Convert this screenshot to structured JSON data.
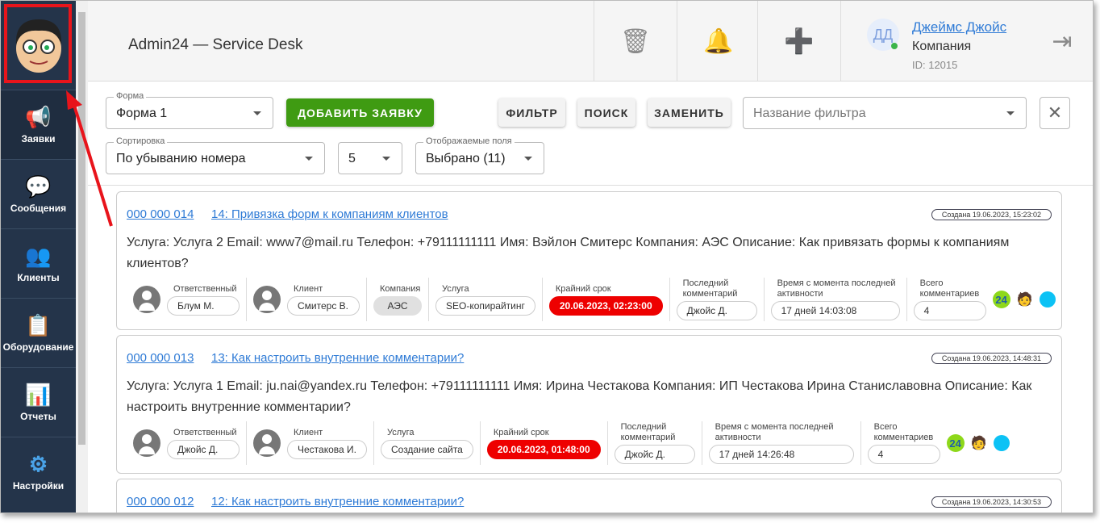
{
  "sidebar": {
    "items": [
      {
        "label": "Заявки",
        "icon": "megaphone-icon"
      },
      {
        "label": "Сообщения",
        "icon": "chat-icon"
      },
      {
        "label": "Клиенты",
        "icon": "clients-icon"
      },
      {
        "label": "Оборудование",
        "icon": "equipment-icon"
      },
      {
        "label": "Отчеты",
        "icon": "reports-icon"
      },
      {
        "label": "Настройки",
        "icon": "gear-icon"
      }
    ]
  },
  "header": {
    "title": "Admin24 — Service Desk",
    "user": {
      "initials": "ДД",
      "name": "Джеймс Джойс",
      "company": "Компания",
      "id": "ID: 12015"
    }
  },
  "toolbar": {
    "form_label": "Форма",
    "form_value": "Форма 1",
    "add_button": "ДОБАВИТЬ ЗАЯВКУ",
    "filter_button": "ФИЛЬТР",
    "search_button": "ПОИСК",
    "replace_button": "ЗАМЕНИТЬ",
    "filter_name_placeholder": "Название фильтра",
    "sort_label": "Сортировка",
    "sort_value": "По убыванию номера",
    "page_size": "5",
    "fields_label": "Отображаемые поля",
    "fields_value": "Выбрано (11)"
  },
  "labels": {
    "responsible": "Ответственный",
    "client": "Клиент",
    "company": "Компания",
    "service": "Услуга",
    "deadline": "Крайний срок",
    "last_comment": "Последний комментарий",
    "since_activity": "Время с момента последней активности",
    "total_comments": "Всего комментариев"
  },
  "tickets": [
    {
      "number": "000 000 014",
      "title": "14: Привязка форм к компаниям клиентов",
      "created": "Создана 19.06.2023, 15:23:02",
      "description": "Услуга: Услуга 2 Email: www7@mail.ru Телефон: +79111111111 Имя: Вэйлон Смитерс Компания: АЭС Описание: Как привязать формы к компаниям клиентов?",
      "responsible": "Блум М.",
      "client": "Смитерс В.",
      "company": "АЭС",
      "service": "SEO-копирайтинг",
      "deadline": "20.06.2023, 02:23:00",
      "last_comment": "Джойс Д.",
      "since_activity": "17 дней 14:03:08",
      "total_comments": "4",
      "badge": "24"
    },
    {
      "number": "000 000 013",
      "title": "13: Как настроить внутренние комментарии?",
      "created": "Создана 19.06.2023, 14:48:31",
      "description": "Услуга: Услуга 1 Email: ju.nai@yandex.ru Телефон: +79111111111 Имя: Ирина Честакова Компания: ИП Честакова Ирина Станиславовна Описание: Как настроить внутренние комментарии?",
      "responsible": "Джойс Д.",
      "client": "Честакова И.",
      "service": "Создание сайта",
      "deadline": "20.06.2023, 01:48:00",
      "last_comment": "Джойс Д.",
      "since_activity": "17 дней 14:26:48",
      "total_comments": "4",
      "badge": "24"
    },
    {
      "number": "000 000 012",
      "title": "12: Как настроить внутренние комментарии?",
      "created": "Создана 19.06.2023, 14:30:53"
    }
  ]
}
